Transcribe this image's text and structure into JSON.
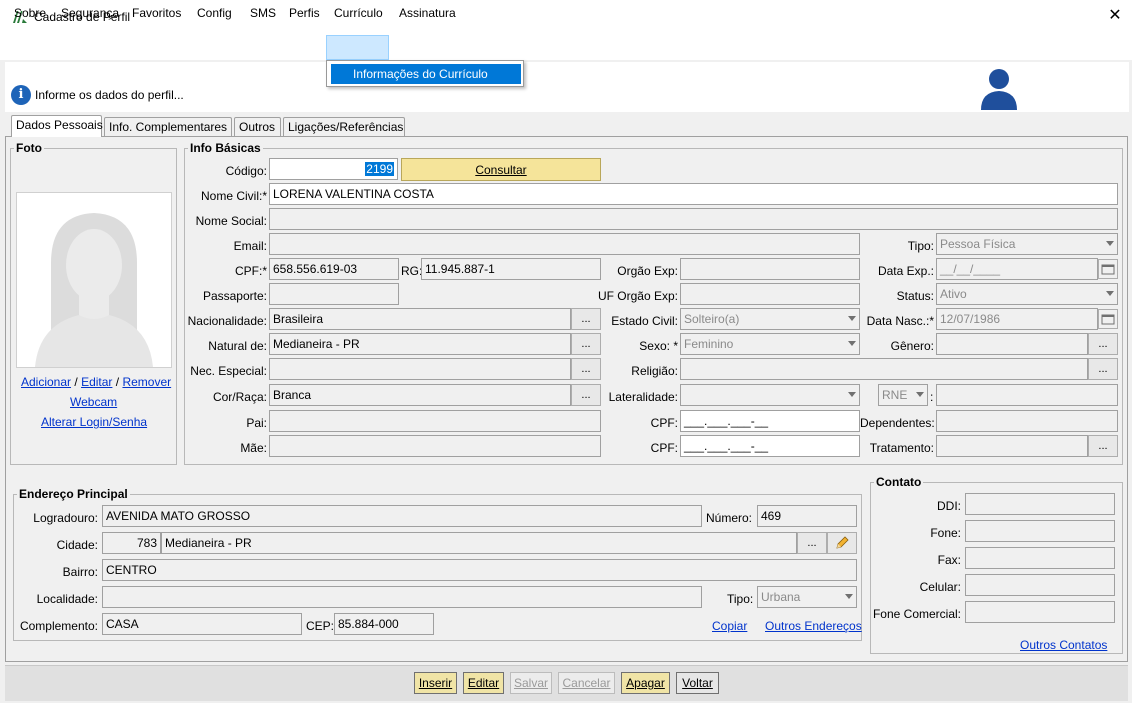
{
  "window": {
    "title": "Cadastro de Perfil",
    "close_glyph": "✕"
  },
  "menu": {
    "items": [
      "Sobre",
      "Segurança",
      "Favoritos",
      "Config",
      "SMS",
      "Perfis",
      "Currículo",
      "Assinatura"
    ],
    "dropdown_item": "Informações do Currículo"
  },
  "info_message": "Informe os dados do perfil...",
  "tabs": [
    "Dados Pessoais",
    "Info. Complementares",
    "Outros",
    "Ligações/Referências"
  ],
  "photo": {
    "group_title": "Foto",
    "link_add": "Adicionar",
    "link_edit": "Editar",
    "link_remove": "Remover",
    "sep": "/",
    "link_webcam": "Webcam",
    "link_login": "Alterar Login/Senha"
  },
  "info_basicas": {
    "group_title": "Info Básicas",
    "codigo_label": "Código:",
    "codigo_value": "2199",
    "consultar_label": "Consultar",
    "nome_civil_label": "Nome Civil:*",
    "nome_civil_value": "LORENA VALENTINA COSTA",
    "nome_social_label": "Nome Social:",
    "nome_social_value": "",
    "email_label": "Email:",
    "email_value": "",
    "tipo_label": "Tipo:",
    "tipo_value": "Pessoa Física",
    "cpf_label": "CPF:*",
    "cpf_value": "658.556.619-03",
    "rg_label": "RG:",
    "rg_value": "11.945.887-1",
    "orgao_exp_label": "Orgão Exp:",
    "orgao_exp_value": "",
    "data_exp_label": "Data Exp.:",
    "data_exp_value": "__/__/____",
    "passaporte_label": "Passaporte:",
    "passaporte_value": "",
    "uf_orgao_label": "UF Orgão Exp:",
    "uf_orgao_value": "",
    "status_label": "Status:",
    "status_value": "Ativo",
    "nacionalidade_label": "Nacionalidade:",
    "nacionalidade_value": "Brasileira",
    "estado_civil_label": "Estado Civil:",
    "estado_civil_value": "Solteiro(a)",
    "data_nasc_label": "Data Nasc.:*",
    "data_nasc_value": "12/07/1986",
    "natural_label": "Natural de:",
    "natural_value": "Medianeira - PR",
    "sexo_label": "Sexo: *",
    "sexo_value": "Feminino",
    "genero_label": "Gênero:",
    "genero_value": "",
    "nec_especial_label": "Nec. Especial:",
    "nec_especial_value": "",
    "religiao_label": "Religião:",
    "religiao_value": "",
    "cor_raca_label": "Cor/Raça:",
    "cor_raca_value": "Branca",
    "lateralidade_label": "Lateralidade:",
    "lateralidade_value": "",
    "rne_value": "RNE",
    "rne_colon": ":",
    "pai_label": "Pai:",
    "pai_value": "",
    "cpf_pai_label": "CPF:",
    "cpf_pai_value": "___.___.___-__",
    "dependentes_label": "Dependentes:",
    "dependentes_value": "",
    "mae_label": "Mãe:",
    "mae_value": "",
    "cpf_mae_label": "CPF:",
    "cpf_mae_value": "___.___.___-__",
    "tratamento_label": "Tratamento:",
    "tratamento_value": "",
    "ellipsis": "..."
  },
  "endereco": {
    "group_title": "Endereço Principal",
    "logradouro_label": "Logradouro:",
    "logradouro_value": "AVENIDA MATO GROSSO",
    "numero_label": "Número:",
    "numero_value": "469",
    "cidade_label": "Cidade:",
    "cidade_code": "783",
    "cidade_value": "Medianeira - PR",
    "bairro_label": "Bairro:",
    "bairro_value": "CENTRO",
    "localidade_label": "Localidade:",
    "localidade_value": "",
    "tipo_label": "Tipo:",
    "tipo_value": "Urbana",
    "complemento_label": "Complemento:",
    "complemento_value": "CASA",
    "cep_label": "CEP:",
    "cep_value": "85.884-000",
    "copiar_link": "Copiar",
    "outros_enderecos_link": "Outros Endereços"
  },
  "contato": {
    "group_title": "Contato",
    "ddi_label": "DDI:",
    "fone_label": "Fone:",
    "fax_label": "Fax:",
    "celular_label": "Celular:",
    "fone_comercial_label": "Fone Comercial:",
    "outros_contatos_link": "Outros Contatos"
  },
  "actions": {
    "inserir": "Inserir",
    "editar": "Editar",
    "salvar": "Salvar",
    "cancelar": "Cancelar",
    "apagar": "Apagar",
    "voltar": "Voltar"
  },
  "colors": {
    "accent": "#0078d7",
    "link": "#0033cc",
    "button_yellow": "#f0e4a6",
    "info_blue": "#1e64b8"
  }
}
